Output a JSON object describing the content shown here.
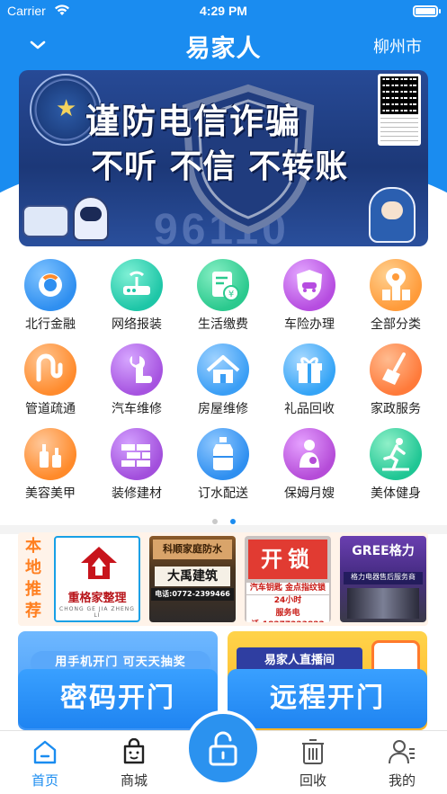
{
  "status_bar": {
    "carrier": "Carrier",
    "time": "4:29 PM"
  },
  "nav": {
    "logo": "易家人",
    "city": "柳州市"
  },
  "banner": {
    "title": "谨防电信诈骗",
    "subtitle": "不听 不信 不转账",
    "watermark": "96110"
  },
  "services": [
    {
      "label": "北行金融",
      "icon": "bank-finance-icon",
      "color": "#2f8ff0"
    },
    {
      "label": "网络报装",
      "icon": "router-icon",
      "color": "#1ec6a7"
    },
    {
      "label": "生活缴费",
      "icon": "bill-icon",
      "color": "#2bc98e"
    },
    {
      "label": "车险办理",
      "icon": "car-insurance-icon",
      "color": "#b64de0"
    },
    {
      "label": "全部分类",
      "icon": "all-categories-icon",
      "color": "#ff9b3a"
    },
    {
      "label": "管道疏通",
      "icon": "pipe-icon",
      "color": "#ff8b2d"
    },
    {
      "label": "汽车维修",
      "icon": "wrench-icon",
      "color": "#a653e0"
    },
    {
      "label": "房屋维修",
      "icon": "house-repair-icon",
      "color": "#3a9ef5"
    },
    {
      "label": "礼品回收",
      "icon": "gift-icon",
      "color": "#35a4f6"
    },
    {
      "label": "家政服务",
      "icon": "broom-icon",
      "color": "#ff7a3a"
    },
    {
      "label": "美容美甲",
      "icon": "beauty-icon",
      "color": "#ff8a2a"
    },
    {
      "label": "装修建材",
      "icon": "bricks-icon",
      "color": "#a24fdc"
    },
    {
      "label": "订水配送",
      "icon": "water-bottle-icon",
      "color": "#2f8ff0"
    },
    {
      "label": "保姆月嫂",
      "icon": "nanny-icon",
      "color": "#b54cd8"
    },
    {
      "label": "美体健身",
      "icon": "fitness-icon",
      "color": "#1fc694"
    }
  ],
  "pager": {
    "pages": 2,
    "active": 2
  },
  "local": {
    "label": "本地推荐",
    "cards": [
      {
        "title": "重格家整理",
        "sub": "CHONG GE JIA ZHENG LI"
      },
      {
        "sign": "科顺家庭防水",
        "title": "大禹建筑",
        "phone": "电话:0772-2399466"
      },
      {
        "sign": "开锁",
        "line1": "汽车钥匙 金点指纹锁",
        "line2": "24小时 18277223822",
        "line3": "服务电话:18277223822"
      },
      {
        "brand": "GREE格力",
        "store": "格力电器售后服务商"
      }
    ]
  },
  "promos": [
    {
      "top": "用手机开门 可天天抽奖",
      "button": "密码开门"
    },
    {
      "top": "易家人直播间",
      "button": "远程开门"
    }
  ],
  "tabs": [
    {
      "label": "首页",
      "icon": "home-icon",
      "active": true
    },
    {
      "label": "商城",
      "icon": "shopping-bag-icon",
      "active": false
    },
    {
      "label": "回收",
      "icon": "recycle-bin-icon",
      "active": false
    },
    {
      "label": "我的",
      "icon": "profile-icon",
      "active": false
    }
  ],
  "colors": {
    "primary": "#1a8cf0",
    "accent_orange": "#ff7f20"
  }
}
